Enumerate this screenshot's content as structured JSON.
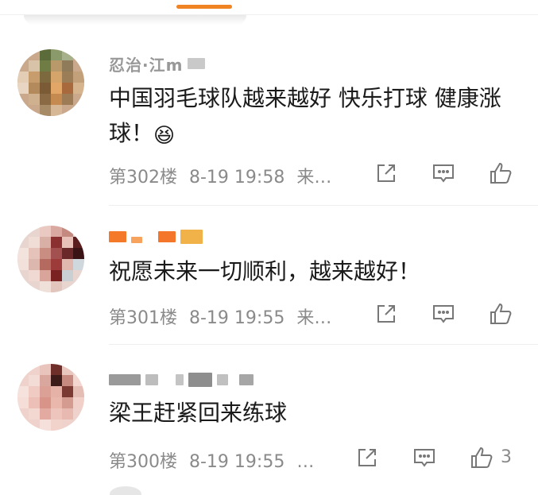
{
  "comments": [
    {
      "username": "忍治·江m",
      "content": "中国羽毛球队越来越好 快乐打球 健康涨球！",
      "emoji": "😆",
      "floor": "第302楼",
      "time": "8-19 19:58",
      "source": "来…",
      "likes": ""
    },
    {
      "username": "",
      "content": "祝愿未来一切顺利，越来越好！",
      "emoji": "",
      "floor": "第301楼",
      "time": "8-19 19:55",
      "source": "来…",
      "likes": ""
    },
    {
      "username": "",
      "content": "梁王赶紧回来练球",
      "emoji": "",
      "floor": "第300楼",
      "time": "8-19 19:55",
      "source": "…",
      "likes": "3"
    }
  ],
  "icons": {
    "share": "share-icon",
    "comment": "comment-icon",
    "like": "like-icon"
  },
  "colors": {
    "accent": "#f08324",
    "meta": "#8a8a8a",
    "text": "#1a1a1a"
  }
}
